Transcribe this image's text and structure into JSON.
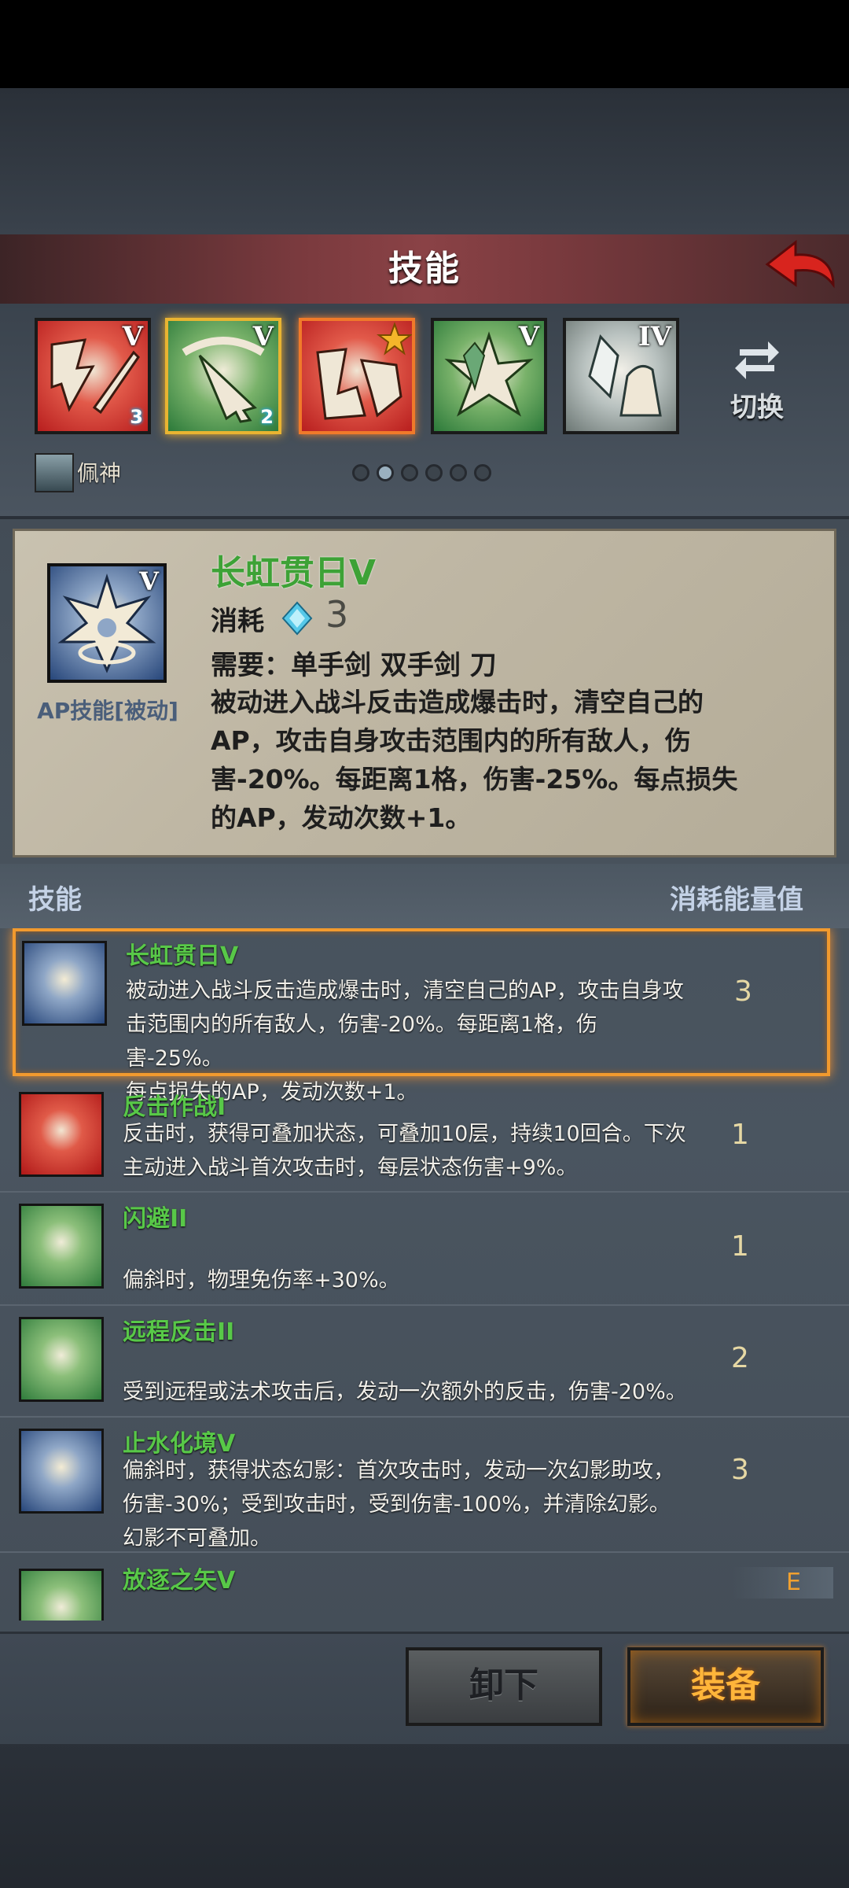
{
  "header": {
    "title": "技能"
  },
  "slots": [
    {
      "level": "V",
      "gem": "3"
    },
    {
      "level": "V",
      "gem": "2"
    },
    {
      "level": ""
    },
    {
      "level": "V"
    },
    {
      "level": "IV"
    }
  ],
  "switch_label": "切换",
  "character": {
    "name": "佩神"
  },
  "pager": {
    "total": 6,
    "current": 2
  },
  "detail": {
    "name": "长虹贯日V",
    "cost_label": "消耗",
    "cost_value": "3",
    "requirement": "需要：单手剑 双手剑 刀",
    "description": "被动进入战斗反击造成爆击时，清空自己的AP，攻击自身攻击范围内的所有敌人，伤害-20%。每距离1格，伤害-25%。每点损失的AP，发动次数+1。",
    "type": "AP技能[被动]"
  },
  "list_header": {
    "skill": "技能",
    "cost": "消耗能量值"
  },
  "skills": [
    {
      "name": "长虹贯日V",
      "desc_lines": [
        "被动进入战斗反击造成爆击时，清空自己的AP，攻击自身攻",
        "击范围内的所有敌人，伤害-20%。每距离1格，伤害-25%。",
        "每点损失的AP，发动次数+1。"
      ],
      "cost": "3"
    },
    {
      "name": "反击作战I",
      "desc_lines": [
        "反击时，获得可叠加状态，可叠加10层，持续10回合。下次",
        "主动进入战斗首次攻击时，每层状态伤害+9%。"
      ],
      "cost": "1"
    },
    {
      "name": "闪避II",
      "desc_lines": [
        "偏斜时，物理免伤率+30%。"
      ],
      "cost": "1"
    },
    {
      "name": "远程反击II",
      "desc_lines": [
        "受到远程或法术攻击后，发动一次额外的反击，伤害-20%。"
      ],
      "cost": "2"
    },
    {
      "name": "止水化境V",
      "desc_lines": [
        "偏斜时，获得状态幻影：首次攻击时，发动一次幻影助攻，",
        "伤害-30%；受到攻击时，受到伤害-100%，并清除幻影。",
        "幻影不可叠加。"
      ],
      "cost": "3"
    },
    {
      "name": "放逐之矢V",
      "desc_lines": [],
      "cost": ""
    }
  ],
  "equipped_tag": "E",
  "buttons": {
    "unequip": "卸下",
    "equip": "装备"
  },
  "colors": {
    "skill_name": "#58c848",
    "accent": "#f29a2e",
    "header": "#7a3a3e"
  }
}
